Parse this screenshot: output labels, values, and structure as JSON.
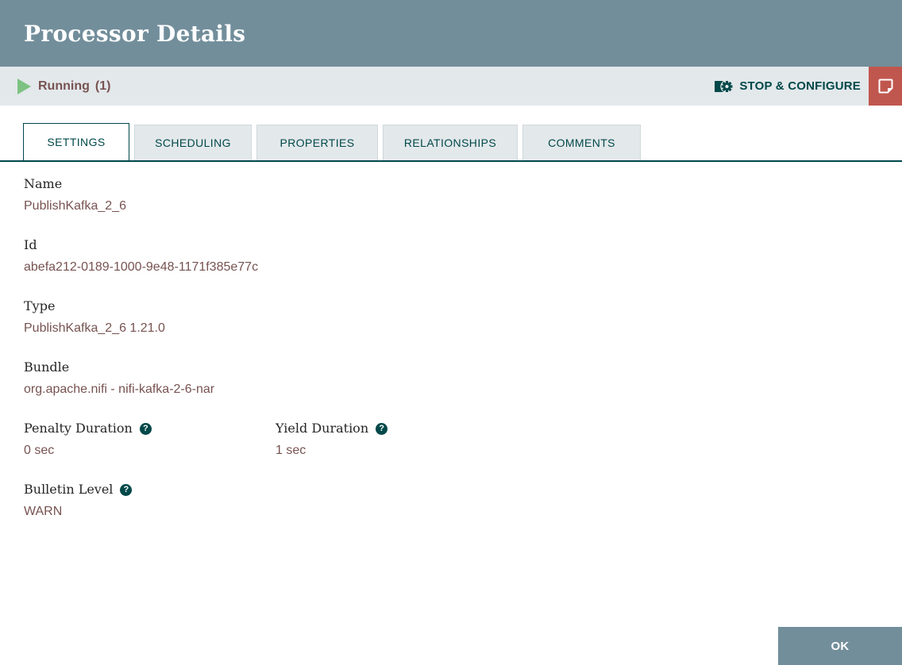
{
  "dialog": {
    "title": "Processor Details"
  },
  "status_bar": {
    "state_label": "Running",
    "state_count": "(1)",
    "stop_configure_label": "STOP & CONFIGURE"
  },
  "tabs": {
    "items": [
      {
        "label": "SETTINGS",
        "active": true
      },
      {
        "label": "SCHEDULING",
        "active": false
      },
      {
        "label": "PROPERTIES",
        "active": false
      },
      {
        "label": "RELATIONSHIPS",
        "active": false
      },
      {
        "label": "COMMENTS",
        "active": false
      }
    ]
  },
  "fields": {
    "name": {
      "label": "Name",
      "value": "PublishKafka_2_6"
    },
    "id": {
      "label": "Id",
      "value": "abefa212-0189-1000-9e48-1171f385e77c"
    },
    "type": {
      "label": "Type",
      "value": "PublishKafka_2_6 1.21.0"
    },
    "bundle": {
      "label": "Bundle",
      "value": "org.apache.nifi - nifi-kafka-2-6-nar"
    },
    "penalty": {
      "label": "Penalty Duration",
      "value": "0 sec",
      "has_help": true
    },
    "yield": {
      "label": "Yield Duration",
      "value": "1 sec",
      "has_help": true
    },
    "bulletin": {
      "label": "Bulletin Level",
      "value": "WARN",
      "has_help": true
    }
  },
  "footer": {
    "ok_label": "OK"
  },
  "icons": {
    "run_state": "play-triangle-icon",
    "stop_configure": "operate-gear-icon",
    "bulletin": "sticky-note-icon",
    "help": "question-circle-icon",
    "help_glyph": "?"
  },
  "colors": {
    "header_bg": "#728e9b",
    "status_bar_bg": "#e3e8eb",
    "accent_teal": "#004849",
    "value_text": "#775351",
    "running_green": "#7dc283",
    "bulletin_red": "#c0574e",
    "ok_button_bg": "#728e9b"
  }
}
